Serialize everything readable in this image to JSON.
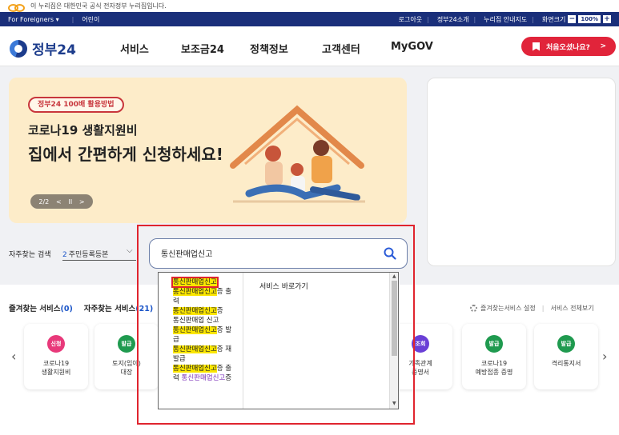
{
  "notice": {
    "text": "이 누리집은 대한민국 공식 전자정부 누리집입니다."
  },
  "topbar": {
    "foreigners": "For Foreigners ▾",
    "easy": "어린이",
    "logout": "로그아웃",
    "about": "정부24소개",
    "sitemap": "누리집 안내지도",
    "zoom_label": "화면크기",
    "zoom_value": "100%",
    "zoom_minus": "−",
    "zoom_plus": "+"
  },
  "header": {
    "brand": "정부24",
    "nav": [
      "서비스",
      "보조금24",
      "정책정보",
      "고객센터",
      "MyGOV"
    ],
    "cta": "처음오셨나요?",
    "cta_arrow": ">"
  },
  "banner": {
    "pill": "정부24 100배 활용방법",
    "subtitle": "코로나19 생활지원비",
    "title": "집에서 간편하게 신청하세요!",
    "pager": "2/2",
    "prev": "<",
    "pause": "II",
    "next": ">"
  },
  "frequent": {
    "label": "자주찾는 검색",
    "rank": "2",
    "item": "주민등록등본",
    "chevron": "⌵"
  },
  "search": {
    "value": "통신판매업신고"
  },
  "dropdown": {
    "suggestions": [
      {
        "hl": "통신판매업신고",
        "rest": ""
      },
      {
        "hl": "통신판매업신고",
        "rest": "증 출"
      },
      {
        "hl": "",
        "rest": "력"
      },
      {
        "hl": "통신판매업신고",
        "rest": "증"
      },
      {
        "hl": "",
        "rest": "통신판매업 신고"
      },
      {
        "hl": "통신판매업신고",
        "rest": "증 발"
      },
      {
        "hl": "",
        "rest": "급"
      },
      {
        "hl": "통신판매업신고",
        "rest": "증 재"
      },
      {
        "hl": "",
        "rest": "발급"
      },
      {
        "hl": "통신판매업신고",
        "rest": "증 출"
      }
    ],
    "last_row_prefix": "력",
    "last_row_link": "통신판매업신고",
    "last_row_suffix": "증",
    "shortcut_title": "서비스 바로가기"
  },
  "services": {
    "tab_favorite": "즐겨찾는 서비스",
    "tab_favorite_count": "(0)",
    "tab_frequent": "자주찾는 서비스",
    "tab_frequent_count": "(21)",
    "settings": "즐겨찾는서비스 설정",
    "view_all": "서비스 전체보기",
    "prev": "‹",
    "next": "›",
    "cards": [
      {
        "badge": "신청",
        "color": "#e8397a",
        "l1": "코로나19",
        "l2": "생활지원비"
      },
      {
        "badge": "발급",
        "color": "#1f9a4f",
        "l1": "토지(임야)",
        "l2": "대장"
      },
      {
        "badge": "조회",
        "color": "#6a3fd6",
        "l1": "가족관계",
        "l2": "증명서"
      },
      {
        "badge": "발급",
        "color": "#1f9a4f",
        "l1": "코로나19",
        "l2": "예방접종 증명"
      },
      {
        "badge": "발급",
        "color": "#1f9a4f",
        "l1": "격리통지서",
        "l2": ""
      }
    ]
  }
}
